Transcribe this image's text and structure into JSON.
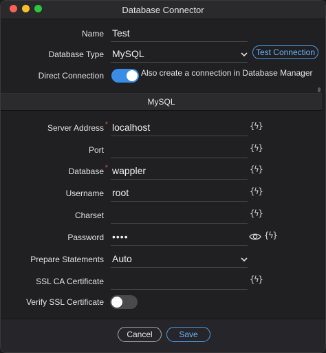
{
  "window": {
    "title": "Database Connector"
  },
  "general": {
    "name_label": "Name",
    "name_value": "Test",
    "db_type_label": "Database Type",
    "db_type_value": "MySQL",
    "test_button": "Test Connection",
    "direct_label": "Direct Connection",
    "direct_on": true,
    "direct_note": "Also create a connection in Database Manager"
  },
  "section": {
    "title": "MySQL"
  },
  "fields": {
    "server_label": "Server Address",
    "server_value": "localhost",
    "port_label": "Port",
    "port_value": "",
    "database_label": "Database",
    "database_value": "wappler",
    "username_label": "Username",
    "username_value": "root",
    "charset_label": "Charset",
    "charset_value": "",
    "password_label": "Password",
    "password_value": "••••",
    "prepare_label": "Prepare Statements",
    "prepare_value": "Auto",
    "sslca_label": "SSL CA Certificate",
    "sslca_value": "",
    "verify_label": "Verify SSL Certificate",
    "verify_on": false,
    "dynamic_icon_glyph": "{ϟ}",
    "required_mark": "*"
  },
  "footer": {
    "cancel": "Cancel",
    "save": "Save"
  },
  "colors": {
    "accent": "#3a8de6",
    "accent_text": "#6cb4ff",
    "required": "#e64a4a"
  },
  "icons": [
    "close-dot",
    "minimize-dot",
    "maximize-dot",
    "chevron-down-icon",
    "dynamic-data-icon",
    "eye-icon"
  ]
}
